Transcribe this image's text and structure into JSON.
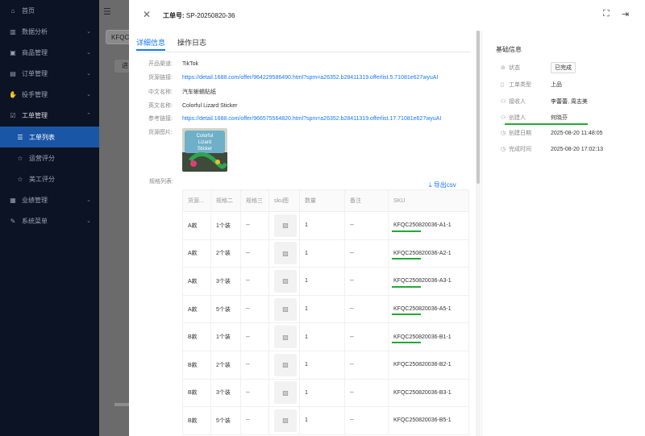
{
  "sidebar": {
    "items": [
      {
        "icon": "home-icon",
        "glyph": "⌂",
        "label": "首页",
        "chevron": ""
      },
      {
        "icon": "chart-icon",
        "glyph": "▥",
        "label": "数据分析",
        "chevron": "⌄"
      },
      {
        "icon": "product-icon",
        "glyph": "▣",
        "label": "商品管理",
        "chevron": "⌄"
      },
      {
        "icon": "order-icon",
        "glyph": "▤",
        "label": "订单管理",
        "chevron": "⌄"
      },
      {
        "icon": "hand-icon",
        "glyph": "✋",
        "label": "投手管理",
        "chevron": "⌄"
      },
      {
        "icon": "ticket-icon",
        "glyph": "☑",
        "label": "工单管理",
        "chevron": "⌃"
      },
      {
        "icon": "list-icon",
        "glyph": "☰",
        "label": "工单列表",
        "chevron": ""
      },
      {
        "icon": "star-icon",
        "glyph": "☆",
        "label": "运营评分",
        "chevron": ""
      },
      {
        "icon": "star-icon",
        "glyph": "☆",
        "label": "美工评分",
        "chevron": ""
      },
      {
        "icon": "performance-icon",
        "glyph": "▦",
        "label": "业绩管理",
        "chevron": "⌄"
      },
      {
        "icon": "wrench-icon",
        "glyph": "✎",
        "label": "系统菜单",
        "chevron": "⌄"
      }
    ]
  },
  "background": {
    "pill1": "KFQC",
    "pill2": "进"
  },
  "drawer": {
    "title_label": "工单号:",
    "title_value": "SP-20250820-36",
    "tabs": [
      "详细信息",
      "操作日志"
    ],
    "fields": [
      {
        "k": "开品渠道:",
        "v": "TikTok",
        "link": false
      },
      {
        "k": "货源链接:",
        "v": "https://detail.1688.com/offer/964229586490.html?spm=a26352.b28411319.offerlist.5.71081e627wyuAI",
        "link": true
      },
      {
        "k": "中文名称:",
        "v": "汽车蜥蜴贴纸",
        "link": false
      },
      {
        "k": "英文名称:",
        "v": "Colorful Lizard Sticker",
        "link": false
      },
      {
        "k": "参考链接:",
        "v": "https://detail.1688.com/offer/966575564820.html?spm=a26352.b28411319.offerlist.17.71081e627wyuAI",
        "link": true
      },
      {
        "k": "货源图片:",
        "v": "",
        "link": false
      }
    ],
    "thumb_text": [
      "Colorful",
      "Lizard",
      "Sticker"
    ],
    "spec_label": "规格列表:",
    "export_label": "导出csv",
    "table": {
      "headers": [
        "货源...",
        "规格二",
        "规格三",
        "sku图",
        "数量",
        "备注",
        "SKU"
      ],
      "rows": [
        {
          "a": "A款",
          "b": "1个装",
          "c": "--",
          "qty": "1",
          "note": "--",
          "sku": "KFQC250820036-A1-1",
          "mark": true
        },
        {
          "a": "A款",
          "b": "2个装",
          "c": "--",
          "qty": "1",
          "note": "--",
          "sku": "KFQC250820036-A2-1",
          "mark": true
        },
        {
          "a": "A款",
          "b": "3个装",
          "c": "--",
          "qty": "1",
          "note": "--",
          "sku": "KFQC250820036-A3-1",
          "mark": true
        },
        {
          "a": "A款",
          "b": "5个装",
          "c": "--",
          "qty": "1",
          "note": "--",
          "sku": "KFQC250820036-A5-1",
          "mark": true
        },
        {
          "a": "B款",
          "b": "1个装",
          "c": "--",
          "qty": "1",
          "note": "--",
          "sku": "KFQC250820036-B1-1",
          "mark": true
        },
        {
          "a": "B款",
          "b": "2个装",
          "c": "--",
          "qty": "1",
          "note": "--",
          "sku": "KFQC250820036-B2-1",
          "mark": false
        },
        {
          "a": "B款",
          "b": "3个装",
          "c": "--",
          "qty": "1",
          "note": "--",
          "sku": "KFQC250820036-B3-1",
          "mark": false
        },
        {
          "a": "B款",
          "b": "5个装",
          "c": "--",
          "qty": "1",
          "note": "--",
          "sku": "KFQC250820036-B5-1",
          "mark": false
        }
      ]
    }
  },
  "info": {
    "title": "基础信息",
    "rows": [
      {
        "icon": "status-icon",
        "glyph": "⊘",
        "k": "状态",
        "v": "已完成",
        "badge": true
      },
      {
        "icon": "document-icon",
        "glyph": "▯",
        "k": "工单类型",
        "v": "上品",
        "badge": false
      },
      {
        "icon": "user-icon",
        "glyph": "⚇",
        "k": "接收人",
        "v": "李蕾蕾, 周志美",
        "badge": false
      },
      {
        "icon": "user-icon",
        "glyph": "⚇",
        "k": "创建人",
        "v": "何晓芬",
        "badge": false
      },
      {
        "icon": "clock-icon",
        "glyph": "◷",
        "k": "创建日期",
        "v": "2025-08-20 11:48:05",
        "badge": false
      },
      {
        "icon": "clock-icon",
        "glyph": "◷",
        "k": "完成时间",
        "v": "2025-08-20 17:02:13",
        "badge": false
      }
    ]
  },
  "colors": {
    "accent": "#1677ff",
    "sidebar": "#0b1324",
    "active": "#1a56a6",
    "highlight": "#22aa33"
  }
}
